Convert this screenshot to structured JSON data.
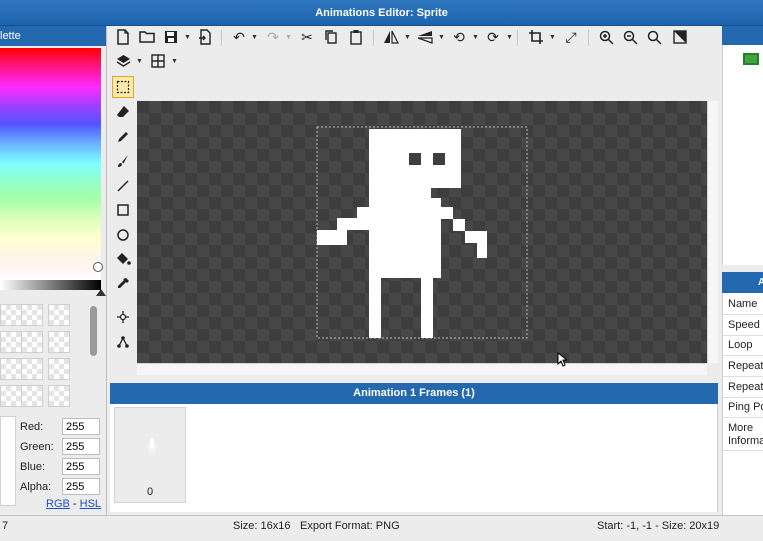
{
  "window": {
    "title": "Animations Editor: Sprite"
  },
  "palette": {
    "header": "lette",
    "red_label": "Red:",
    "red_value": "255",
    "green_label": "Green:",
    "green_value": "255",
    "blue_label": "Blue:",
    "blue_value": "255",
    "alpha_label": "Alpha:",
    "alpha_value": "255",
    "mode_rgb": "RGB",
    "mode_sep": "-",
    "mode_hsl": "HSL"
  },
  "toolbar": {
    "row1": [
      "new-file-icon",
      "open-folder-icon",
      "save-icon",
      "export-icon",
      "undo-icon",
      "redo-icon",
      "cut-icon",
      "copy-icon",
      "paste-icon",
      "flip-horizontal-icon",
      "flip-vertical-icon",
      "rotate-left-icon",
      "rotate-right-icon",
      "crop-icon",
      "resize-icon",
      "zoom-in-icon",
      "zoom-out-icon",
      "zoom-fit-icon",
      "contrast-icon"
    ],
    "row2": [
      "layers-icon",
      "grid-icon"
    ]
  },
  "tools": [
    "rect-select-icon",
    "eraser-icon",
    "pencil-icon",
    "brush-icon",
    "line-icon",
    "rectangle-icon",
    "ellipse-icon",
    "fill-bucket-icon",
    "eyedropper-icon",
    "move-point-icon",
    "node-icon"
  ],
  "frames": {
    "header": "Animation 1 Frames (1)",
    "items": [
      {
        "index": "0"
      }
    ]
  },
  "properties": {
    "header": "A",
    "rows": [
      "Name",
      "Speed",
      "Loop",
      "Repeat",
      "Repeat",
      "Ping Po",
      "More Informa"
    ]
  },
  "status": {
    "left": "7",
    "size": "Size: 16x16",
    "format": "Export Format: PNG",
    "selection": "Start: -1, -1 - Size: 20x19"
  },
  "colors": {
    "accent": "#2468b0",
    "canvas_bg": "#3e3e3e",
    "sprite": "#ffffff",
    "green_item": "#3fa63f"
  }
}
